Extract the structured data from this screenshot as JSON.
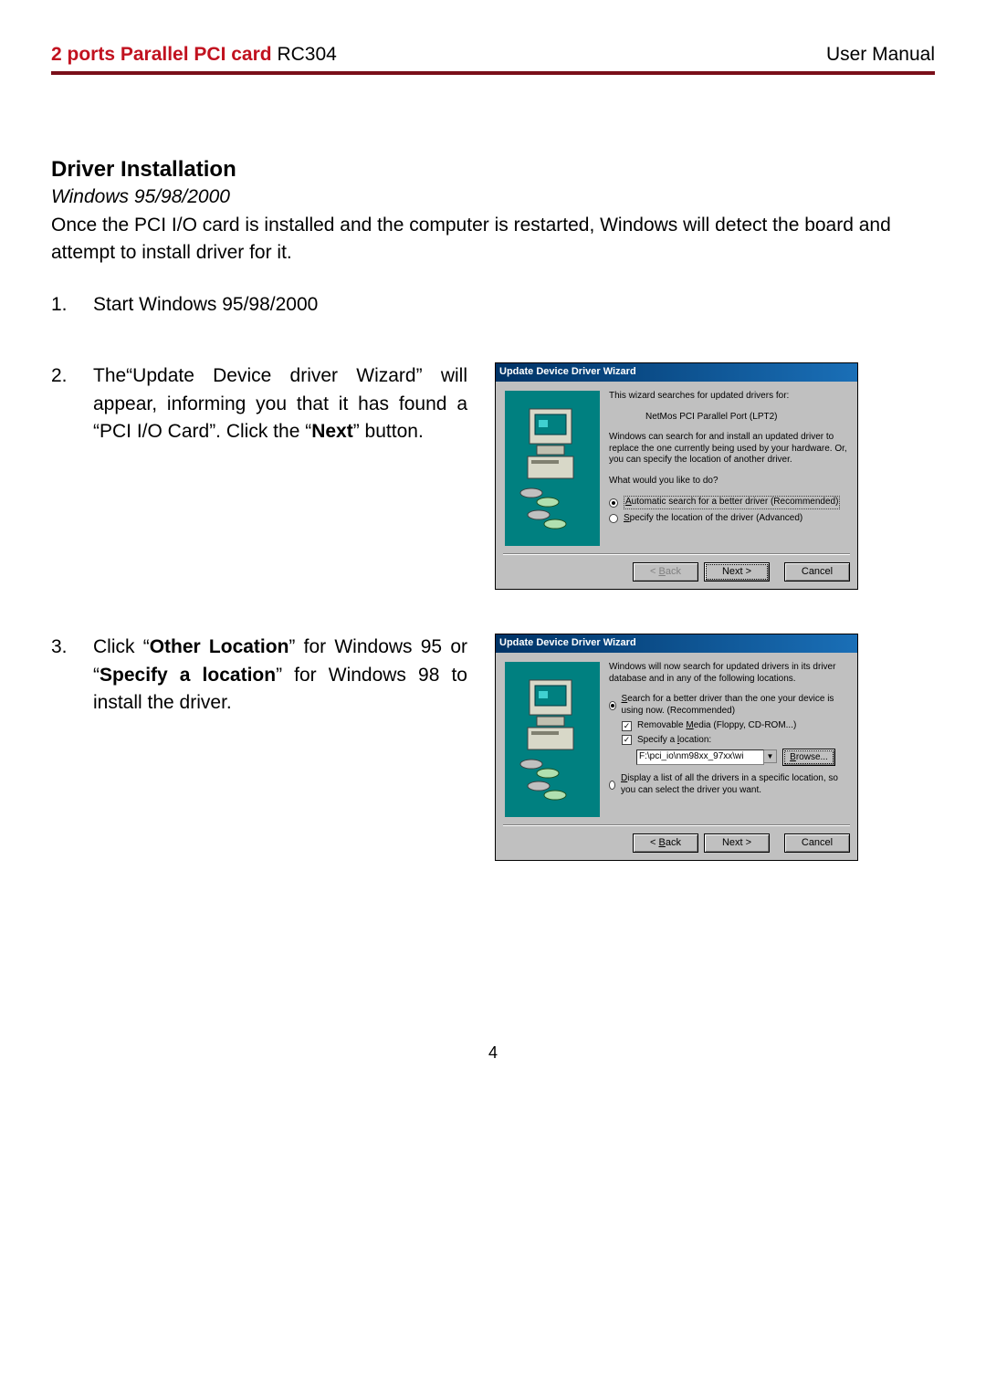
{
  "header": {
    "product_name": "2 ports Parallel PCI card",
    "model": "RC304",
    "doc_type": "User Manual"
  },
  "section": {
    "title": "Driver Installation",
    "os_line": "Windows 95/98/2000",
    "intro": "Once the PCI I/O card is installed and the computer is restarted, Windows will detect the board and attempt to install driver for it."
  },
  "steps": {
    "s1": {
      "num": "1.",
      "text": "Start Windows 95/98/2000"
    },
    "s2": {
      "num": "2.",
      "pre": "The“Update Device driver Wizard” will appear, informing you that it has found a “PCI I/O Card”. Click the “",
      "bold": "Next",
      "post": "” button."
    },
    "s3": {
      "num": "3.",
      "t1": "Click “",
      "b1": "Other Location",
      "t2": "” for Windows 95 or “",
      "b2": "Specify a location",
      "t3": "” for Windows 98 to install the driver."
    }
  },
  "wizard1": {
    "title": "Update Device Driver Wizard",
    "line1": "This wizard searches for updated drivers for:",
    "device": "NetMos PCI Parallel Port (LPT2)",
    "line2": "Windows can search for and install an updated driver to replace the one currently being used by your hardware. Or, you can specify the location of another driver.",
    "line3": "What would you like to do?",
    "opt1_pre": "A",
    "opt1_rest": "utomatic search for a better driver (Recommended)",
    "opt2_pre": "S",
    "opt2_rest": "pecify the location of the driver (Advanced)",
    "back_pre": "< ",
    "back_u": "B",
    "back_rest": "ack",
    "next": "Next >",
    "cancel": "Cancel"
  },
  "wizard2": {
    "title": "Update Device Driver Wizard",
    "line1": "Windows will now search for updated drivers in its driver database and in any of the following locations.",
    "opt1_pre": "S",
    "opt1_rest": "earch for a better driver than the one your device is using now. (Recommended)",
    "chk1_pre": "Removable ",
    "chk1_u": "M",
    "chk1_rest": "edia (Floppy, CD-ROM...)",
    "chk2_pre": "Specify a ",
    "chk2_u": "l",
    "chk2_rest": "ocation:",
    "path": "F:\\pci_io\\nm98xx_97xx\\wi",
    "browse_u": "B",
    "browse_rest": "rowse...",
    "opt2_pre": "D",
    "opt2_rest": "isplay a list of all the drivers in a specific location, so you can select the driver you want.",
    "back_pre": "< ",
    "back_u": "B",
    "back_rest": "ack",
    "next": "Next >",
    "cancel": "Cancel"
  },
  "page_number": "4"
}
